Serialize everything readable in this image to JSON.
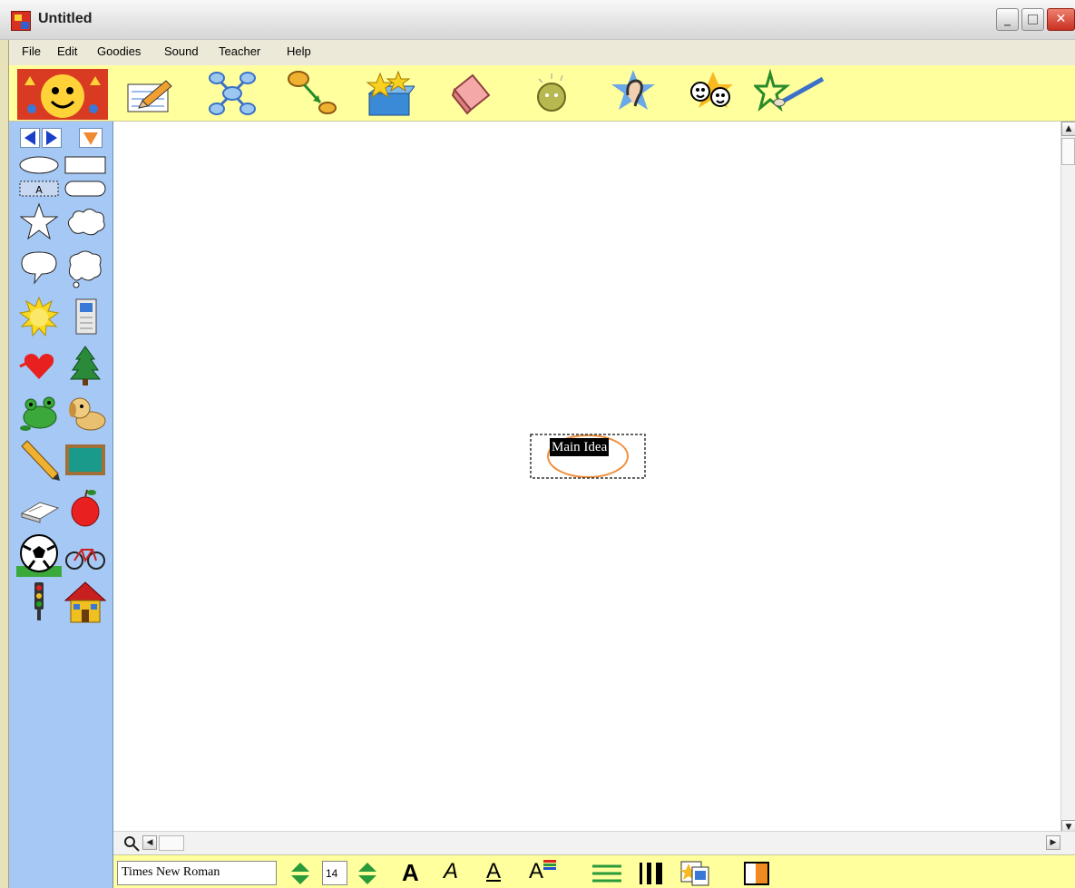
{
  "window": {
    "title": "Untitled"
  },
  "menu": {
    "items": [
      "File",
      "Edit",
      "Goodies",
      "Sound",
      "Teacher",
      "Help"
    ]
  },
  "toolbar": {
    "tools": [
      "pencil-icon",
      "diagram-icon",
      "link-arrow-icon",
      "symbol-box-icon",
      "eraser-icon",
      "bulb-icon",
      "ear-icon",
      "theater-masks-icon",
      "star-paintbrush-icon"
    ]
  },
  "palette": {
    "symbols": [
      "oval-shape",
      "rectangle-shape",
      "text-box-shape",
      "rounded-rectangle-shape",
      "star-shape",
      "cloud-shape",
      "speech-bubble-shape",
      "thought-bubble-shape",
      "sun-icon",
      "notebook-icon",
      "heart-icon",
      "tree-icon",
      "frog-icon",
      "dog-icon",
      "pencil-icon",
      "chalkboard-icon",
      "book-icon",
      "apple-icon",
      "soccer-ball-icon",
      "bicycle-icon",
      "traffic-light-icon",
      "house-icon"
    ]
  },
  "canvas": {
    "main_node_label": "Main Idea"
  },
  "format": {
    "font_name": "Times New Roman",
    "font_size": "14",
    "bold_label": "A",
    "italic_label": "A",
    "underline_label": "A",
    "color_label": "A"
  },
  "colors": {
    "toolbar": "#ffff9e",
    "palette": "#a6c8f4",
    "accent": "#f0903c"
  }
}
